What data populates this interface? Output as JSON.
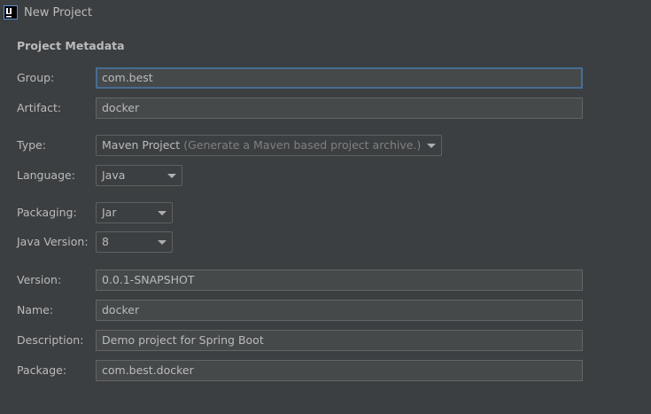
{
  "window": {
    "title": "New Project",
    "icon": "intellij-idea-icon"
  },
  "section": {
    "title": "Project Metadata"
  },
  "form": {
    "group": {
      "label": "Group:",
      "value": "com.best"
    },
    "artifact": {
      "label": "Artifact:",
      "value": "docker"
    },
    "type": {
      "label": "Type:",
      "value": "Maven Project",
      "hint": "(Generate a Maven based project archive.)"
    },
    "language": {
      "label": "Language:",
      "value": "Java"
    },
    "packaging": {
      "label": "Packaging:",
      "value": "Jar"
    },
    "java_version": {
      "label": "Java Version:",
      "value": "8"
    },
    "version": {
      "label": "Version:",
      "value": "0.0.1-SNAPSHOT"
    },
    "name": {
      "label": "Name:",
      "value": "docker"
    },
    "description": {
      "label": "Description:",
      "value": "Demo project for Spring Boot"
    },
    "package": {
      "label": "Package:",
      "value": "com.best.docker"
    }
  },
  "colors": {
    "background": "#3c3f41",
    "field_background": "#45494a",
    "focus_border": "#466d94",
    "text": "#bbbbbb",
    "hint_text": "#808080"
  }
}
